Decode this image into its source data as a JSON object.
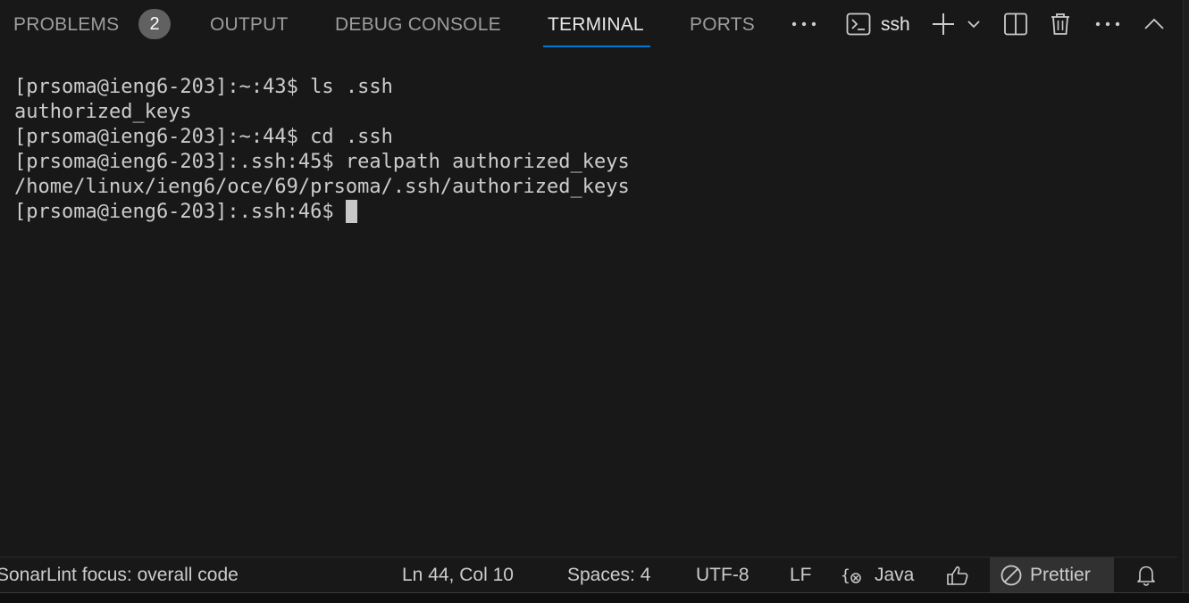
{
  "panel": {
    "tabs": [
      {
        "label": "PROBLEMS",
        "active": false
      },
      {
        "label": "OUTPUT",
        "active": false
      },
      {
        "label": "DEBUG CONSOLE",
        "active": false
      },
      {
        "label": "TERMINAL",
        "active": true
      },
      {
        "label": "PORTS",
        "active": false
      }
    ],
    "problems_badge": "2",
    "terminal_name": "ssh",
    "icons": [
      "more-tabs-icon",
      "terminal-icon",
      "add-terminal-icon",
      "chevron-down-icon",
      "split-terminal-icon",
      "trash-icon",
      "more-actions-icon",
      "chevron-up-icon"
    ]
  },
  "terminal": {
    "lines": [
      "[prsoma@ieng6-203]:~:43$ ls .ssh",
      "authorized_keys",
      "[prsoma@ieng6-203]:~:44$ cd .ssh",
      "[prsoma@ieng6-203]:.ssh:45$ realpath authorized_keys",
      "/home/linux/ieng6/oce/69/prsoma/.ssh/authorized_keys"
    ],
    "current_prompt": "[prsoma@ieng6-203]:.ssh:46$ "
  },
  "status_bar": {
    "sonarlint": "SonarLint focus: overall code",
    "position": "Ln 44, Col 10",
    "spaces": "Spaces: 4",
    "encoding": "UTF-8",
    "eol": "LF",
    "language": "Java",
    "formatter": "Prettier",
    "icons": [
      "language-status-icon",
      "feedback-icon",
      "prettier-disabled-icon",
      "bell-icon"
    ]
  },
  "colors": {
    "background": "#181818",
    "active_tab_underline": "#0078d4",
    "text": "#cccccc",
    "badge": "#616161"
  }
}
